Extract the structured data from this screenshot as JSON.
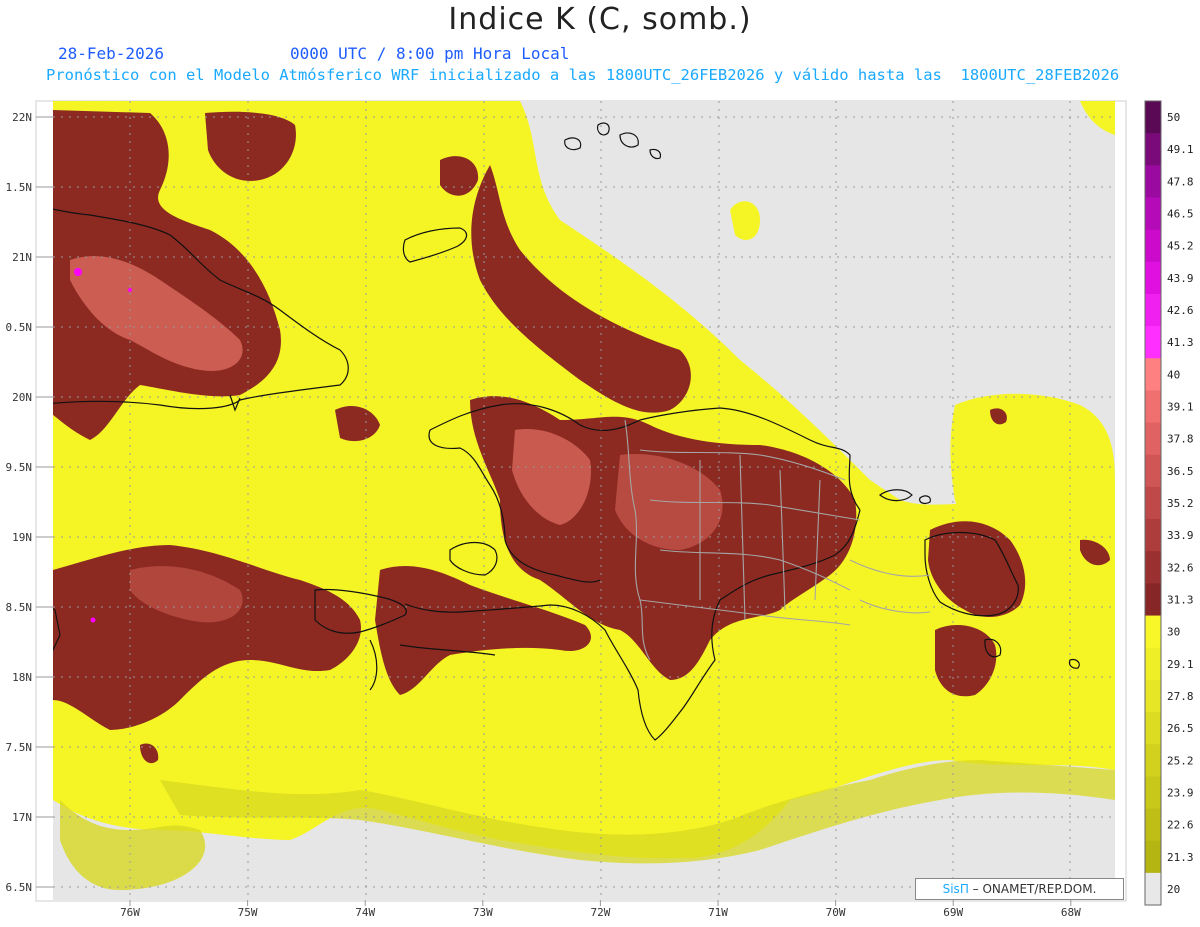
{
  "header": {
    "title": "Indice K (C, somb.)",
    "date": "28-Feb-2026",
    "time": "0000 UTC / 8:00 pm Hora Local",
    "forecast": "Pronóstico con el Modelo Atmósferico WRF inicializado a las 1800UTC_26FEB2026 y válido hasta las  1800UTC_28FEB2026"
  },
  "axes": {
    "lat_labels": [
      "22N",
      "1.5N",
      "21N",
      "0.5N",
      "20N",
      "9.5N",
      "19N",
      "8.5N",
      "18N",
      "7.5N",
      "17N",
      "6.5N"
    ],
    "lon_labels": [
      "76W",
      "75W",
      "74W",
      "73W",
      "72W",
      "71W",
      "70W",
      "69W",
      "68W"
    ]
  },
  "colorbar": {
    "labels": [
      "50",
      "49.1",
      "47.8",
      "46.5",
      "45.2",
      "43.9",
      "42.6",
      "41.3",
      "40",
      "39.1",
      "37.8",
      "36.5",
      "35.2",
      "33.9",
      "32.6",
      "31.3",
      "30",
      "29.1",
      "27.8",
      "26.5",
      "25.2",
      "23.9",
      "22.6",
      "21.3",
      "20"
    ],
    "colors": [
      "#5a0a55",
      "#7a0a7a",
      "#9a0aa0",
      "#b40ab8",
      "#cc0acc",
      "#e010e0",
      "#f020f0",
      "#ff30ff",
      "#ff8080",
      "#f07070",
      "#e06262",
      "#d05555",
      "#bf4848",
      "#ad3c3c",
      "#9a3030",
      "#872626",
      "#f7f72a",
      "#efef28",
      "#e6e626",
      "#dcdc22",
      "#d2d21e",
      "#c8c81a",
      "#bebe16",
      "#b4b412",
      "#e8e8e8"
    ]
  },
  "credit": {
    "brand": "SisΠ",
    "text": "– ONAMET/REP.DOM."
  },
  "colors": {
    "ocean_gray": "#e6e6e6",
    "low_yellow": "#f5f526",
    "dark_yellow": "#d8d822",
    "brown": "#8c2a22",
    "pink": "#e07a70",
    "magenta": "#ff00ff",
    "coast": "#111111",
    "borders": "#a0a0a0",
    "subtitle_blue": "#1f5cff",
    "forecast_blue": "#1aa9ff"
  }
}
